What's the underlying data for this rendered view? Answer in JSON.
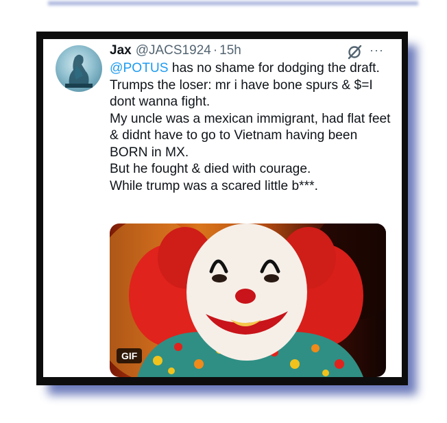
{
  "tweet": {
    "author_name": "Jax",
    "handle": "@JACS1924",
    "separator": "·",
    "time": "15h",
    "more_label": "···",
    "mention": "@POTUS",
    "line1_rest": " has no shame for dodging the draft.",
    "lines": [
      "Trumps the loser: mr i have bone spurs & $=I dont wanna fight.",
      "My uncle was a mexican immigrant, had flat feet & didnt have to go to Vietnam having been BORN in MX.",
      "But he fought & died with courage.",
      "While trump was a scared little b***."
    ]
  },
  "media": {
    "badge": "GIF",
    "icon": "clown-gif-image"
  },
  "colors": {
    "link": "#1d9bf0",
    "frame": "#0d0d0d",
    "shadow": "#5566b0",
    "text": "#0f1419",
    "muted": "#536471"
  }
}
